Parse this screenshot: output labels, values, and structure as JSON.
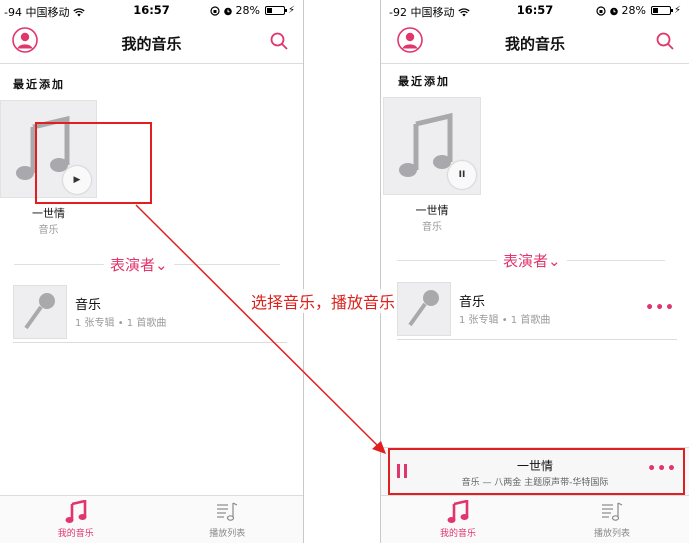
{
  "left": {
    "status": {
      "carrier": "-94 中国移动",
      "time": "16:57",
      "battery": "28%"
    },
    "nav": {
      "title": "我的音乐"
    },
    "recent_label": "最近添加",
    "album": {
      "title": "一世情",
      "subtitle": "音乐",
      "state_glyph": "▶"
    },
    "performers_label": "表演者",
    "artist": {
      "name": "音乐",
      "meta": "1 张专辑 • 1 首歌曲"
    },
    "tabs": [
      {
        "label": "我的音乐",
        "active": true
      },
      {
        "label": "播放列表",
        "active": false
      }
    ]
  },
  "right": {
    "status": {
      "carrier": "-92 中国移动",
      "time": "16:57",
      "battery": "28%"
    },
    "nav": {
      "title": "我的音乐"
    },
    "recent_label": "最近添加",
    "album": {
      "title": "一世情",
      "subtitle": "音乐",
      "state_glyph": "II"
    },
    "performers_label": "表演者",
    "artist": {
      "name": "音乐",
      "meta": "1 张专辑 • 1 首歌曲",
      "more": "•••"
    },
    "mini_player": {
      "title": "一世情",
      "subtitle": "音乐 — 八两金 主题原声带-华特国际",
      "more": "•••"
    },
    "tabs": [
      {
        "label": "我的音乐",
        "active": true
      },
      {
        "label": "播放列表",
        "active": false
      }
    ]
  },
  "annotation": {
    "text": "选择音乐，播放音乐"
  },
  "colors": {
    "accent": "#e0366d",
    "annotation": "#e02020"
  }
}
